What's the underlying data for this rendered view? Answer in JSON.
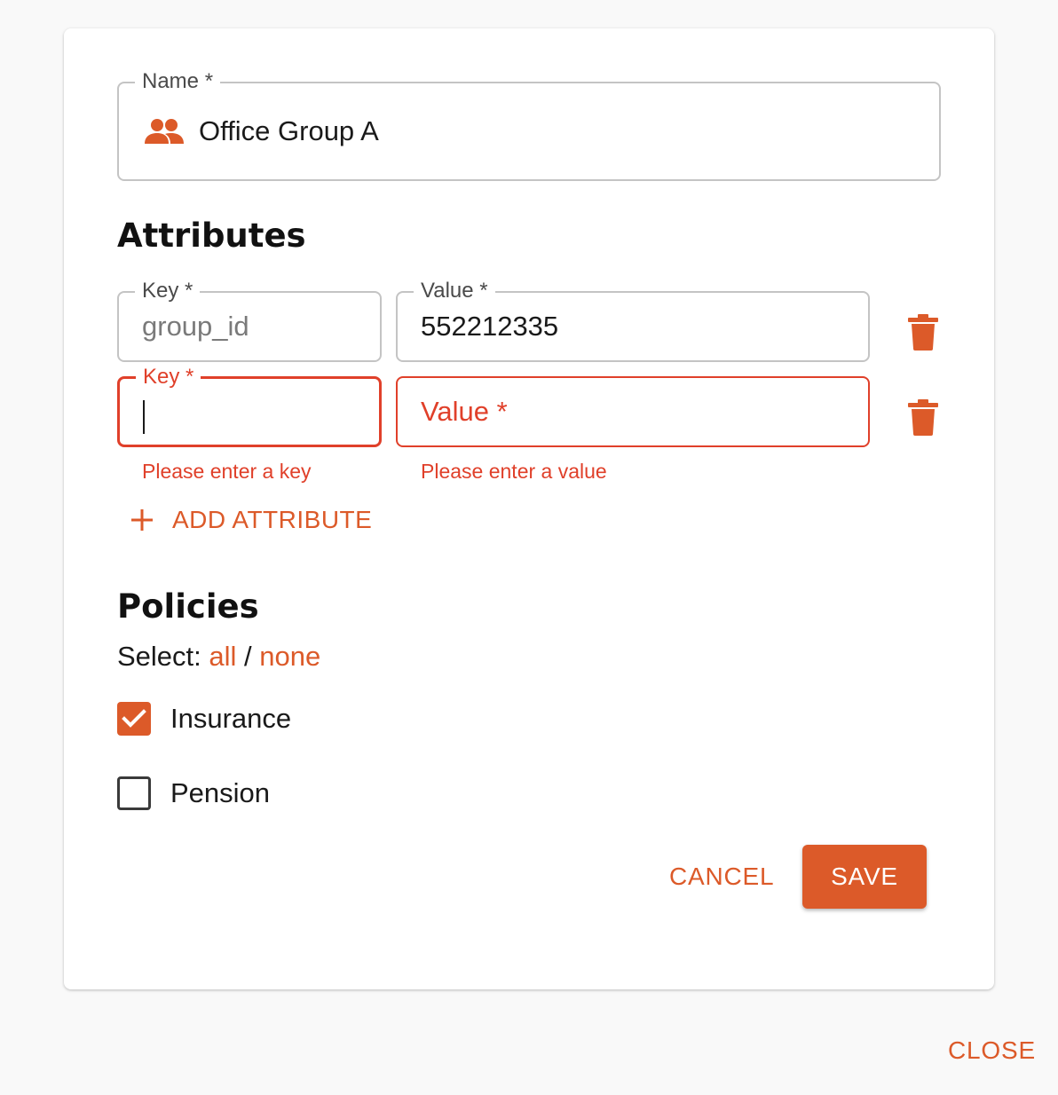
{
  "colors": {
    "accent": "#dc5a29",
    "error": "#e0402a",
    "border": "#c4c4c4"
  },
  "name_field": {
    "label": "Name *",
    "value": "Office Group A",
    "icon": "group-icon"
  },
  "attributes": {
    "heading": "Attributes",
    "rows": [
      {
        "key_label": "Key *",
        "key_value": "group_id",
        "value_label": "Value *",
        "value_value": "552212335",
        "delete_icon": "trash-icon"
      },
      {
        "key_label": "Key *",
        "key_value": "",
        "value_placeholder": "Value *",
        "key_error": "Please enter a key",
        "value_error": "Please enter a value",
        "delete_icon": "trash-icon"
      }
    ],
    "add_label": "ADD ATTRIBUTE"
  },
  "policies": {
    "heading": "Policies",
    "select_prefix": "Select:",
    "select_all": "all",
    "select_sep": "/",
    "select_none": "none",
    "items": [
      {
        "label": "Insurance",
        "checked": true
      },
      {
        "label": "Pension",
        "checked": false
      }
    ]
  },
  "actions": {
    "cancel": "CANCEL",
    "save": "SAVE",
    "close": "CLOSE"
  }
}
